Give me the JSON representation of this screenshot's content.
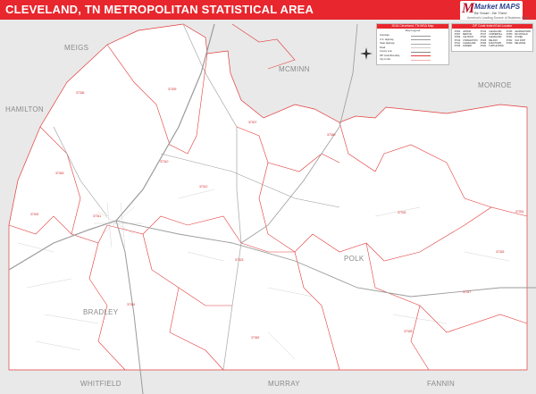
{
  "header": {
    "title": "CLEVELAND, TN METROPOLITAN STATISTICAL AREA"
  },
  "logo": {
    "name": "Market MAPS",
    "tagline": "Be Smart - Be There",
    "subtag": "America's Leading Source of Business Maps"
  },
  "colors": {
    "header_bg": "#e8262d",
    "zip_boundary": "#e33b3b",
    "county_label": "#8a8a8a",
    "outside_area": "#e9e9e9",
    "road": "#9a9a9a"
  },
  "county_labels": [
    {
      "id": "meigs",
      "text": "MEIGS"
    },
    {
      "id": "mcminn",
      "text": "MCMINN"
    },
    {
      "id": "monroe",
      "text": "MONROE"
    },
    {
      "id": "hamilton",
      "text": "HAMILTON"
    },
    {
      "id": "polk",
      "text": "POLK"
    },
    {
      "id": "bradley",
      "text": "BRADLEY"
    },
    {
      "id": "whitfield",
      "text": "WHITFIELD"
    },
    {
      "id": "murray",
      "text": "MURRAY"
    },
    {
      "id": "fannin",
      "text": "FANNIN"
    }
  ],
  "zip_labels": [
    {
      "id": "z1",
      "text": "37336"
    },
    {
      "id": "z2",
      "text": "37309"
    },
    {
      "id": "z3",
      "text": "37302"
    },
    {
      "id": "z4",
      "text": "37353"
    },
    {
      "id": "z5",
      "text": "37310"
    },
    {
      "id": "z6",
      "text": "37311"
    },
    {
      "id": "z7",
      "text": "37312"
    },
    {
      "id": "z8",
      "text": "37307"
    },
    {
      "id": "z9",
      "text": "37391"
    },
    {
      "id": "z10",
      "text": "37326"
    },
    {
      "id": "z11",
      "text": "37323"
    },
    {
      "id": "z12",
      "text": "37361"
    },
    {
      "id": "z13",
      "text": "37369"
    },
    {
      "id": "z14",
      "text": "37317"
    },
    {
      "id": "z15",
      "text": "37333"
    },
    {
      "id": "z16",
      "text": "37362"
    },
    {
      "id": "z17",
      "text": "37325"
    }
  ],
  "legend_panel": {
    "title": "2016 Cleveland, TN MSA Map",
    "subtitle": "Map Legend",
    "rows": [
      "Interstate",
      "U.S. Highway",
      "State Highway",
      "Road",
      "County Line",
      "ZIP Code Boundary",
      "City Limits"
    ]
  },
  "zip_panel": {
    "title": "ZIP Code Index/Grid Locator",
    "rows": [
      [
        "37302",
        "APISON",
        "37312",
        "CLEVELAND",
        "37336",
        "GEORGETOWN"
      ],
      [
        "37307",
        "BENTON",
        "37317",
        "COPPERHILL",
        "37353",
        "MC DONALD"
      ],
      [
        "37309",
        "CALHOUN",
        "37323",
        "CLEVELAND",
        "37361",
        "OCOEE"
      ],
      [
        "37310",
        "CHARLESTON",
        "37325",
        "DELANO",
        "37362",
        "OLD FORT"
      ],
      [
        "37311",
        "CLEVELAND",
        "37326",
        "DUCKTOWN",
        "37369",
        "RELIANCE"
      ],
      [
        "37333",
        "FARNER",
        "37391",
        "TURTLETOWN",
        "",
        ""
      ]
    ]
  }
}
